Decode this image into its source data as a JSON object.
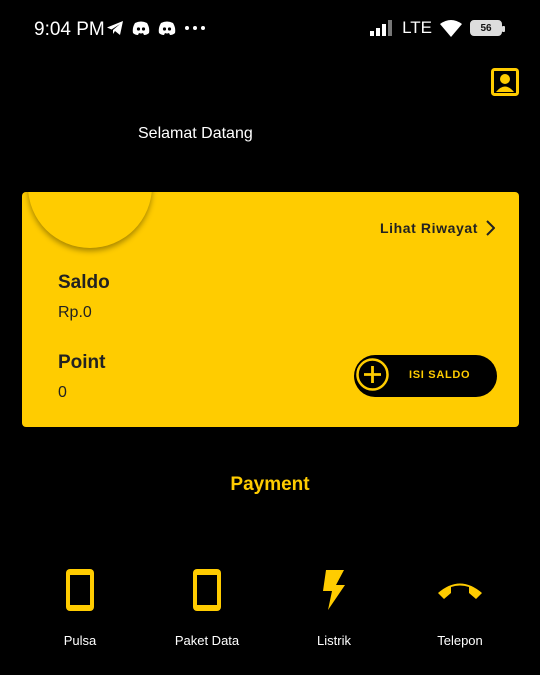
{
  "status_bar": {
    "time": "9:04 PM",
    "network": "LTE",
    "battery": "56",
    "left_icons": [
      "telegram-icon",
      "discord-icon",
      "discord-icon",
      "more-dots-icon"
    ],
    "right_icons": [
      "signal-icon",
      "wifi-icon",
      "battery-icon"
    ]
  },
  "header": {
    "welcome": "Selamat Datang",
    "profile_icon": "profile-icon"
  },
  "card": {
    "history_link": "Lihat Riwayat",
    "saldo_label": "Saldo",
    "saldo_value": "Rp.0",
    "point_label": "Point",
    "point_value": "0",
    "topup_label": "ISI SALDO"
  },
  "payment": {
    "title": "Payment",
    "items": [
      {
        "label": "Pulsa",
        "icon": "phone-icon"
      },
      {
        "label": "Paket Data",
        "icon": "phone-icon"
      },
      {
        "label": "Listrik",
        "icon": "lightning-icon"
      },
      {
        "label": "Telepon",
        "icon": "call-end-icon"
      }
    ]
  },
  "colors": {
    "background": "#000000",
    "accent": "#FFCC00",
    "card_text": "#222222"
  }
}
